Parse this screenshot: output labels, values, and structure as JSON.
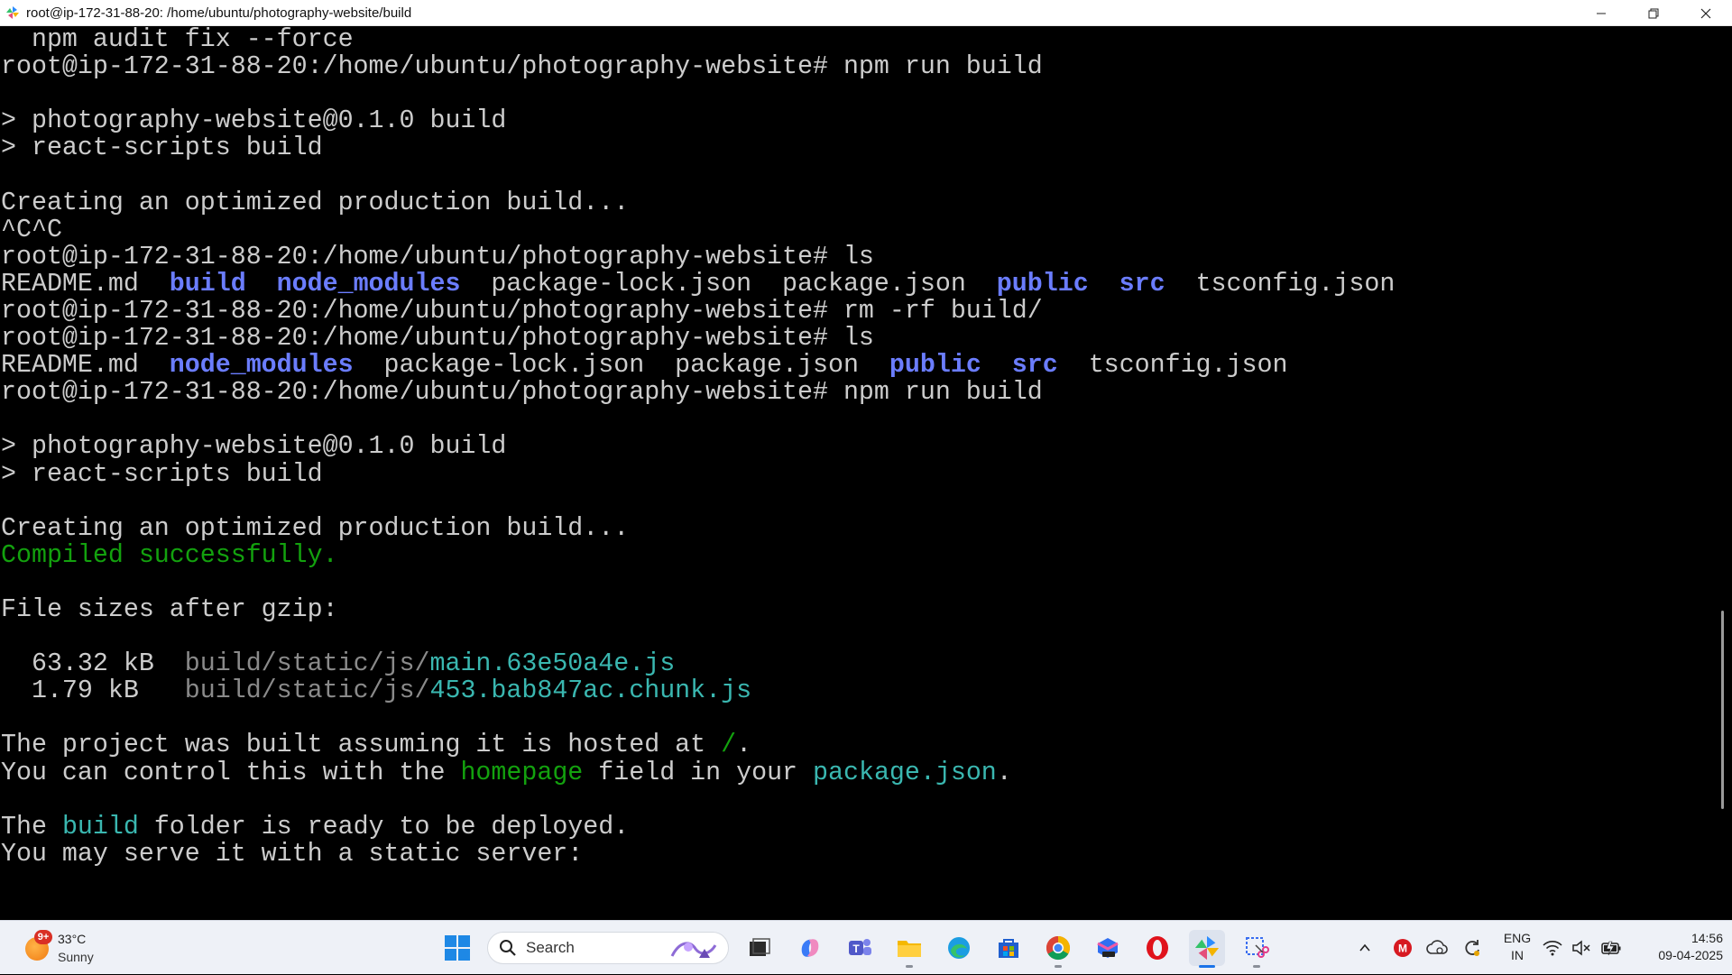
{
  "window": {
    "title": "root@ip-172-31-88-20: /home/ubuntu/photography-website/build",
    "icon": "pinwheel-app-icon",
    "controls": [
      "minimize",
      "restore",
      "close"
    ]
  },
  "terminal": {
    "lines": [
      [
        {
          "t": "  npm audit fix --force",
          "c": "def"
        }
      ],
      [
        {
          "t": "root@ip-172-31-88-20:/home/ubuntu/photography-website# npm run build",
          "c": "def"
        }
      ],
      [
        {
          "t": "",
          "c": "def"
        }
      ],
      [
        {
          "t": "> photography-website@0.1.0 build",
          "c": "def"
        }
      ],
      [
        {
          "t": "> react-scripts build",
          "c": "def"
        }
      ],
      [
        {
          "t": "",
          "c": "def"
        }
      ],
      [
        {
          "t": "Creating an optimized production build...",
          "c": "def"
        }
      ],
      [
        {
          "t": "^C^C",
          "c": "def"
        }
      ],
      [
        {
          "t": "root@ip-172-31-88-20:/home/ubuntu/photography-website# ls",
          "c": "def"
        }
      ],
      [
        {
          "t": "README.md  ",
          "c": "def"
        },
        {
          "t": "build",
          "c": "dir"
        },
        {
          "t": "  ",
          "c": "def"
        },
        {
          "t": "node_modules",
          "c": "dir"
        },
        {
          "t": "  package-lock.json  package.json  ",
          "c": "def"
        },
        {
          "t": "public",
          "c": "dir"
        },
        {
          "t": "  ",
          "c": "def"
        },
        {
          "t": "src",
          "c": "dir"
        },
        {
          "t": "  tsconfig.json",
          "c": "def"
        }
      ],
      [
        {
          "t": "root@ip-172-31-88-20:/home/ubuntu/photography-website# rm -rf build/",
          "c": "def"
        }
      ],
      [
        {
          "t": "root@ip-172-31-88-20:/home/ubuntu/photography-website# ls",
          "c": "def"
        }
      ],
      [
        {
          "t": "README.md  ",
          "c": "def"
        },
        {
          "t": "node_modules",
          "c": "dir"
        },
        {
          "t": "  package-lock.json  package.json  ",
          "c": "def"
        },
        {
          "t": "public",
          "c": "dir"
        },
        {
          "t": "  ",
          "c": "def"
        },
        {
          "t": "src",
          "c": "dir"
        },
        {
          "t": "  tsconfig.json",
          "c": "def"
        }
      ],
      [
        {
          "t": "root@ip-172-31-88-20:/home/ubuntu/photography-website# npm run build",
          "c": "def"
        }
      ],
      [
        {
          "t": "",
          "c": "def"
        }
      ],
      [
        {
          "t": "> photography-website@0.1.0 build",
          "c": "def"
        }
      ],
      [
        {
          "t": "> react-scripts build",
          "c": "def"
        }
      ],
      [
        {
          "t": "",
          "c": "def"
        }
      ],
      [
        {
          "t": "Creating an optimized production build...",
          "c": "def"
        }
      ],
      [
        {
          "t": "Compiled successfully.",
          "c": "green"
        }
      ],
      [
        {
          "t": "",
          "c": "def"
        }
      ],
      [
        {
          "t": "File sizes after gzip:",
          "c": "def"
        }
      ],
      [
        {
          "t": "",
          "c": "def"
        }
      ],
      [
        {
          "t": "  63.32 kB  ",
          "c": "def"
        },
        {
          "t": "build/static/js/",
          "c": "gray"
        },
        {
          "t": "main.63e50a4e.js",
          "c": "cyan"
        }
      ],
      [
        {
          "t": "  1.79 kB   ",
          "c": "def"
        },
        {
          "t": "build/static/js/",
          "c": "gray"
        },
        {
          "t": "453.bab847ac.chunk.js",
          "c": "cyan"
        }
      ],
      [
        {
          "t": "",
          "c": "def"
        }
      ],
      [
        {
          "t": "The project was built assuming it is hosted at ",
          "c": "def"
        },
        {
          "t": "/",
          "c": "green"
        },
        {
          "t": ".",
          "c": "def"
        }
      ],
      [
        {
          "t": "You can control this with the ",
          "c": "def"
        },
        {
          "t": "homepage",
          "c": "green"
        },
        {
          "t": " field in your ",
          "c": "def"
        },
        {
          "t": "package.json",
          "c": "cyan"
        },
        {
          "t": ".",
          "c": "def"
        }
      ],
      [
        {
          "t": "",
          "c": "def"
        }
      ],
      [
        {
          "t": "The ",
          "c": "def"
        },
        {
          "t": "build",
          "c": "cyan"
        },
        {
          "t": " folder is ready to be deployed.",
          "c": "def"
        }
      ],
      [
        {
          "t": "You may serve it with a static server:",
          "c": "def"
        }
      ]
    ]
  },
  "taskbar": {
    "weather": {
      "badge": "9+",
      "temp": "33°C",
      "condition": "Sunny",
      "icon": "sun-icon"
    },
    "search": {
      "label": "Search"
    },
    "apps": [
      {
        "name": "start-button",
        "icon": "windows-logo-icon",
        "active": false,
        "running": false
      },
      {
        "name": "search",
        "icon": "search-icon",
        "active": false,
        "running": false
      },
      {
        "name": "task-view",
        "icon": "task-view-icon",
        "active": false,
        "running": false
      },
      {
        "name": "copilot",
        "icon": "copilot-icon",
        "active": false,
        "running": false
      },
      {
        "name": "teams",
        "icon": "teams-icon",
        "active": false,
        "running": false
      },
      {
        "name": "file-explorer",
        "icon": "folder-icon",
        "active": false,
        "running": true
      },
      {
        "name": "edge",
        "icon": "edge-icon",
        "active": false,
        "running": false
      },
      {
        "name": "store",
        "icon": "store-icon",
        "active": false,
        "running": false
      },
      {
        "name": "chrome",
        "icon": "chrome-icon",
        "active": false,
        "running": true
      },
      {
        "name": "m365",
        "icon": "m365-icon",
        "active": false,
        "running": false
      },
      {
        "name": "opera",
        "icon": "opera-icon",
        "active": false,
        "running": false
      },
      {
        "name": "terminal-app",
        "icon": "pinwheel-app-icon",
        "active": true,
        "running": true
      },
      {
        "name": "snipping-tool",
        "icon": "snipping-tool-icon",
        "active": false,
        "running": true
      }
    ],
    "tray": {
      "icons": [
        "chevron-up-icon",
        "mcafee-icon",
        "cloud-sync-icon",
        "refresh-icon",
        "wifi-icon",
        "volume-muted-icon",
        "battery-icon"
      ],
      "language": {
        "line1": "ENG",
        "line2": "IN"
      },
      "clock": {
        "time": "14:56",
        "date": "09-04-2025"
      }
    }
  },
  "colors": {
    "terminal_bg": "#000000",
    "text_default": "#cccccc",
    "directory": "#6b7dff",
    "success_green": "#13a10e",
    "cyan": "#3ab7b0",
    "gray": "#8a8a8a",
    "taskbar_bg": "#eef1f7"
  }
}
